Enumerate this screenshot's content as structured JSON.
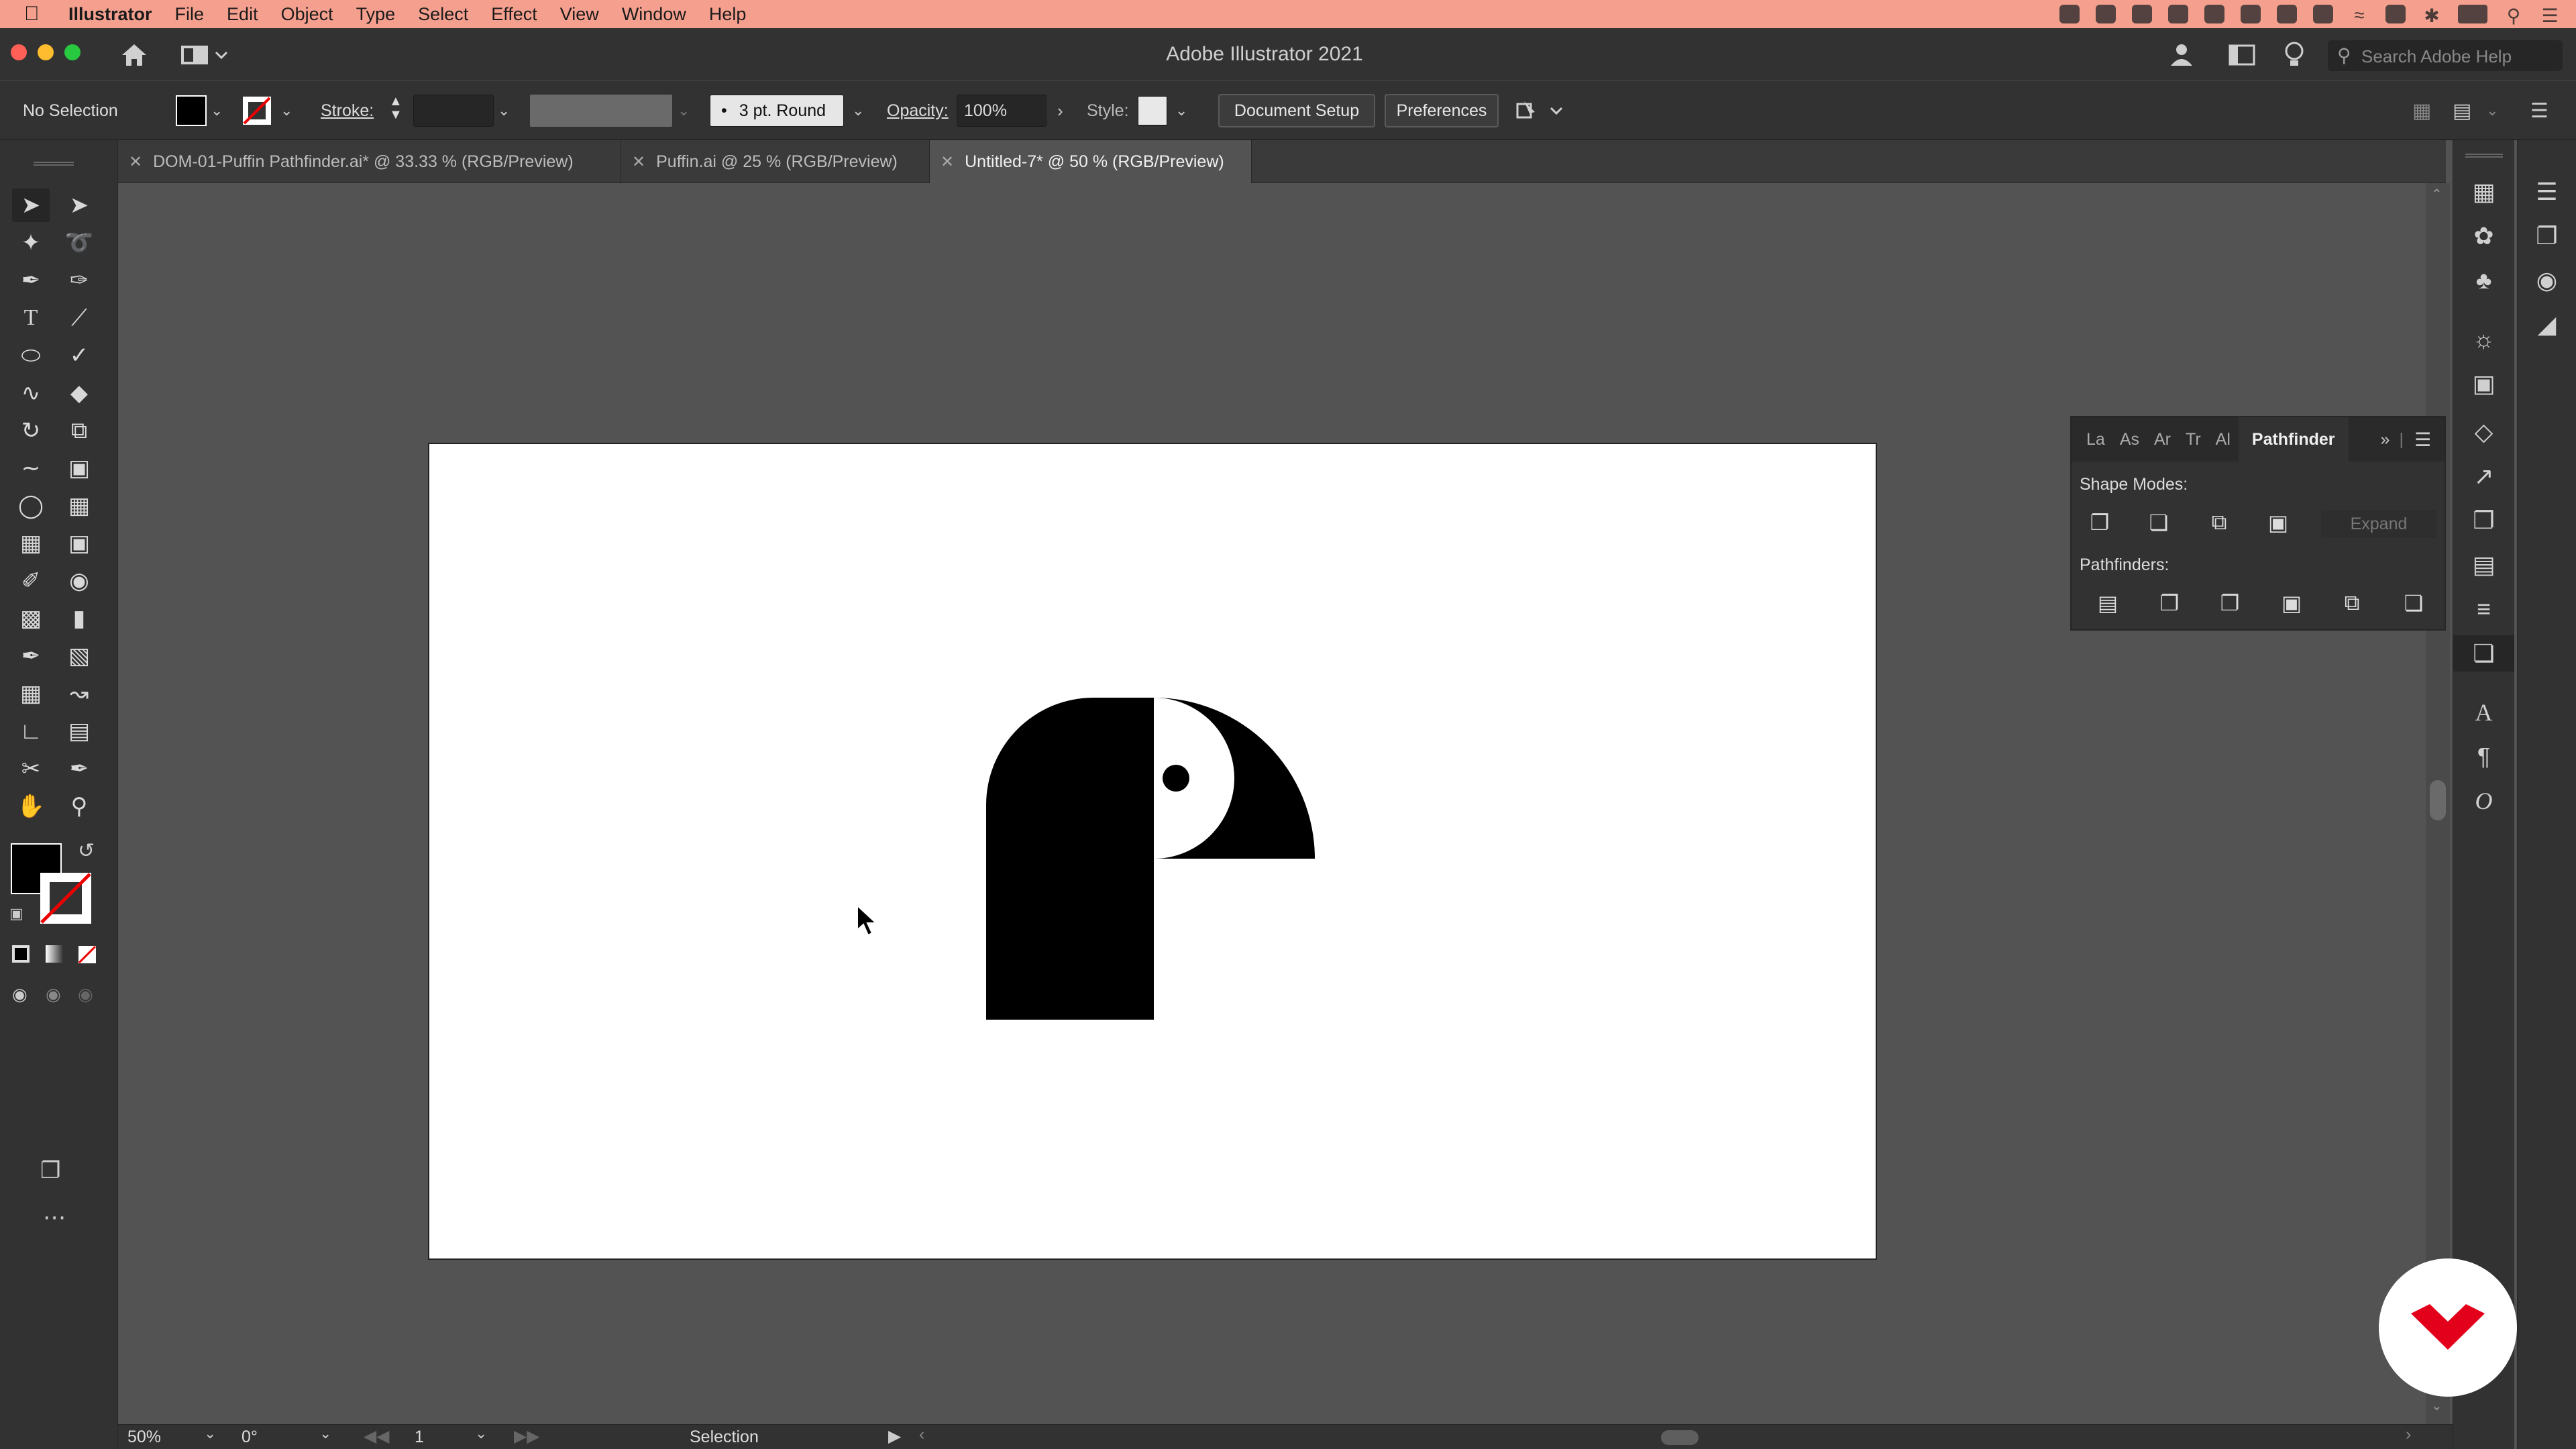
{
  "menubar": {
    "app": "Illustrator",
    "items": [
      "File",
      "Edit",
      "Object",
      "Type",
      "Select",
      "Effect",
      "View",
      "Window",
      "Help"
    ]
  },
  "appbar": {
    "title": "Adobe Illustrator 2021",
    "search_placeholder": "Search Adobe Help"
  },
  "control": {
    "selection": "No Selection",
    "stroke_label": "Stroke:",
    "brush": "3 pt. Round",
    "opacity_label": "Opacity:",
    "opacity_value": "100%",
    "style_label": "Style:",
    "document_setup": "Document Setup",
    "preferences": "Preferences"
  },
  "tabs": [
    {
      "label": "DOM-01-Puffin Pathfinder.ai* @ 33.33 % (RGB/Preview)",
      "active": false
    },
    {
      "label": "Puffin.ai @ 25 % (RGB/Preview)",
      "active": false
    },
    {
      "label": "Untitled-7* @ 50 % (RGB/Preview)",
      "active": true
    }
  ],
  "pathfinder": {
    "tabs": [
      "La",
      "As",
      "Ar",
      "Tr",
      "Al"
    ],
    "active_tab": "Pathfinder",
    "shape_modes_label": "Shape Modes:",
    "expand": "Expand",
    "pathfinders_label": "Pathfinders:"
  },
  "status": {
    "zoom": "50%",
    "rotation": "0°",
    "artboard": "1",
    "tool": "Selection"
  },
  "colors": {
    "menubar": "#f5a08f",
    "ui_dark": "#323232",
    "canvas": "#535353",
    "brand_red": "#e3001b"
  }
}
